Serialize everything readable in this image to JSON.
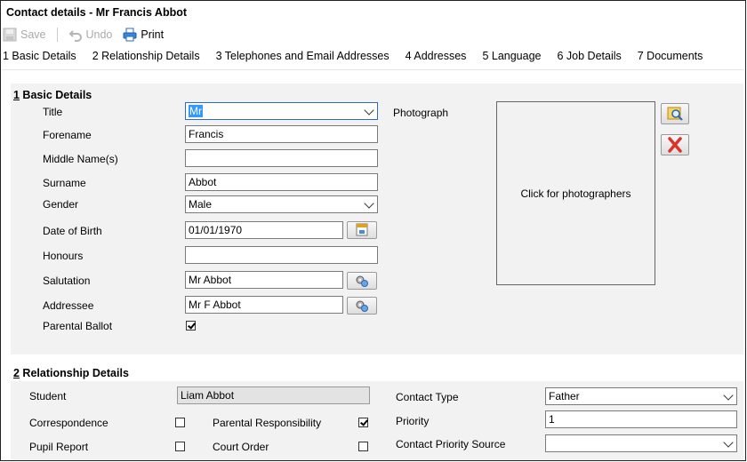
{
  "window": {
    "title": "Contact details - Mr Francis Abbot"
  },
  "toolbar": {
    "save": "Save",
    "undo": "Undo",
    "print": "Print"
  },
  "tabs": [
    "1 Basic Details",
    "2 Relationship Details",
    "3 Telephones and Email Addresses",
    "4 Addresses",
    "5 Language",
    "6 Job Details",
    "7 Documents"
  ],
  "basic": {
    "heading_num": "1",
    "heading_text": " Basic Details",
    "title_label": "Title",
    "title_value": "Mr",
    "forename_label": "Forename",
    "forename_value": "Francis",
    "middle_label": "Middle Name(s)",
    "middle_value": "",
    "surname_label": "Surname",
    "surname_value": "Abbot",
    "gender_label": "Gender",
    "gender_value": "Male",
    "dob_label": "Date of Birth",
    "dob_value": "01/01/1970",
    "honours_label": "Honours",
    "honours_value": "",
    "salutation_label": "Salutation",
    "salutation_value": "Mr Abbot",
    "addressee_label": "Addressee",
    "addressee_value": "Mr F Abbot",
    "ballot_label": "Parental Ballot",
    "ballot_checked": true,
    "photo_label": "Photograph",
    "photo_text": "Click for photographers"
  },
  "relationship": {
    "heading_num": "2",
    "heading_text": " Relationship Details",
    "student_label": "Student",
    "student_value": "Liam Abbot",
    "correspondence_label": "Correspondence",
    "correspondence_checked": false,
    "pupil_report_label": "Pupil Report",
    "pupil_report_checked": false,
    "parental_resp_label": "Parental Responsibility",
    "parental_resp_checked": true,
    "court_order_label": "Court Order",
    "court_order_checked": false,
    "contact_type_label": "Contact Type",
    "contact_type_value": "Father",
    "priority_label": "Priority",
    "priority_value": "1",
    "cps_label": "Contact Priority Source",
    "cps_value": ""
  }
}
